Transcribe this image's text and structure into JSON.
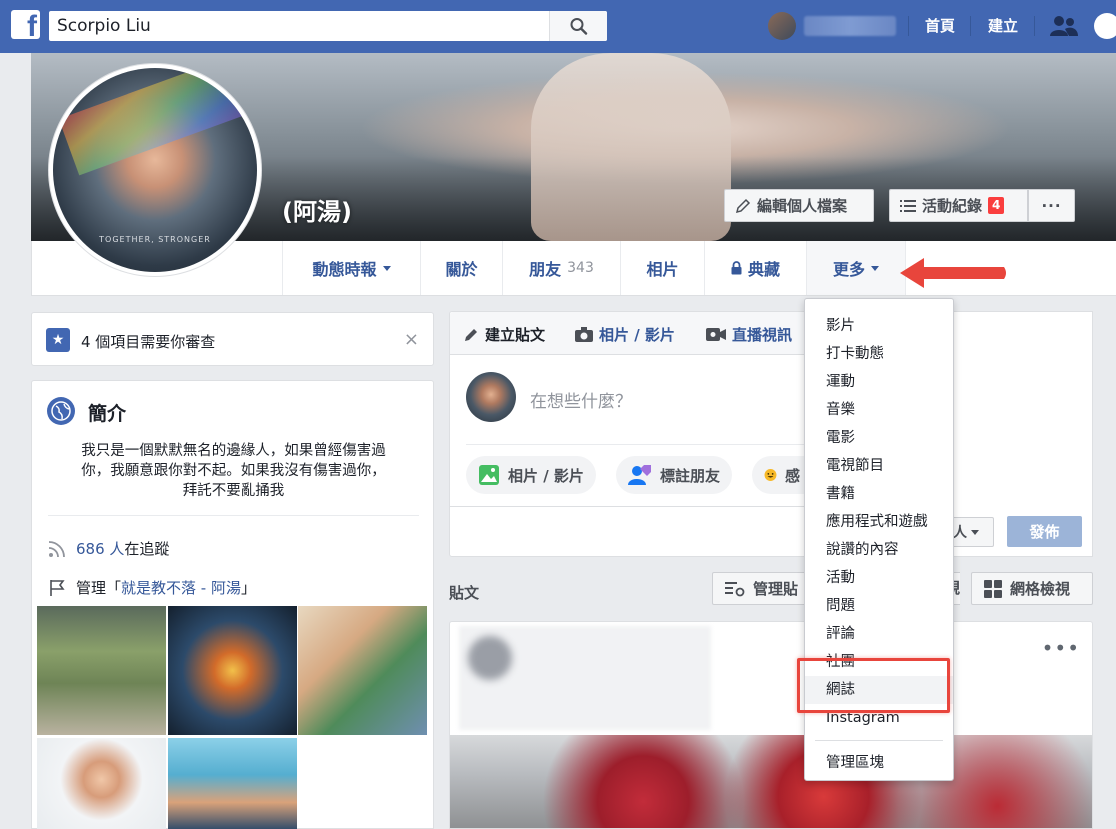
{
  "topbar": {
    "search_value": "Scorpio Liu",
    "home_label": "首頁",
    "create_label": "建立",
    "brand_color": "#4267b2"
  },
  "cover": {
    "name": "(阿湯)",
    "edit_profile_label": "編輯個人檔案",
    "activity_log_label": "活動紀錄",
    "activity_log_badge": "4",
    "more_dots": "···",
    "propic_caption": "TOGETHER, STRONGER"
  },
  "profile_nav": {
    "timeline_label": "動態時報",
    "about_label": "關於",
    "friends_label": "朋友",
    "friends_count": "343",
    "photos_label": "相片",
    "archive_label": "典藏",
    "more_label": "更多"
  },
  "review": {
    "text": "4 個項目需要你審查",
    "close": "×"
  },
  "intro": {
    "title": "簡介",
    "bio_line1": "我只是一個默默無名的邊緣人，如果曾經傷害過",
    "bio_line2": "你，我願意跟你對不起。如果我沒有傷害過你，",
    "bio_line3": "拜託不要亂捅我",
    "followers_count": "686 人",
    "followers_suffix": "在追蹤",
    "manage_prefix": "管理「",
    "manage_page": "就是教不落 - 阿湯",
    "manage_suffix": "」"
  },
  "composer": {
    "tab_create_post": "建立貼文",
    "tab_photo_video": "相片 / 影片",
    "tab_live": "直播視訊",
    "placeholder": "在想些什麼？",
    "pill_photo": "相片 / 影片",
    "pill_tag": "標註朋友",
    "pill_feeling": "感",
    "audience": "人",
    "post_button": "發佈"
  },
  "posts": {
    "label": "貼文",
    "manage_label": "管理貼",
    "list_view_label": "視",
    "grid_view_label": "網格檢視",
    "more_dots": "•••"
  },
  "more_menu": {
    "items": [
      "影片",
      "打卡動態",
      "運動",
      "音樂",
      "電影",
      "電視節目",
      "書籍",
      "應用程式和遊戲",
      "說讚的內容",
      "活動",
      "問題",
      "評論",
      "社團",
      "網誌",
      "Instagram"
    ],
    "manage_sections": "管理區塊",
    "highlighted": "網誌"
  },
  "annotation": {
    "arrow_color": "#e8453c"
  }
}
